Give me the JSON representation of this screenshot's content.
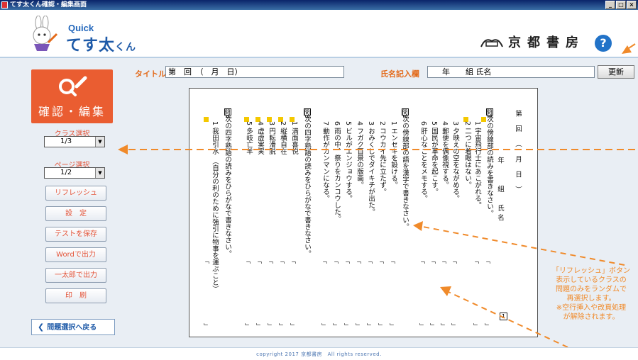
{
  "window": {
    "title": "てす太くん確認・編集画面",
    "buttons": [
      "_",
      "□",
      "×"
    ]
  },
  "header": {
    "logo_small": "Quick",
    "logo_main": "てす太",
    "logo_suffix": "くん",
    "publisher": "京都書房",
    "help": "?"
  },
  "topbar": {
    "title_label": "タイトル",
    "title_value": "第　回　（　月　日）",
    "name_label": "氏名記入欄",
    "name_value": "年　　組 氏名",
    "update_label": "更新"
  },
  "sidebar": {
    "main_button": "確認・編集",
    "class_label": "クラス選択",
    "class_value": "1/3",
    "page_label": "ページ選択",
    "page_value": "1/2",
    "buttons": [
      "リフレッシュ",
      "設　定",
      "テストを保存",
      "Wordで出力",
      "一太郎で出力",
      "印　刷"
    ],
    "back": "問題選択へ戻る"
  },
  "document": {
    "header_col": [
      "第",
      "回",
      "（",
      "月",
      "日）"
    ],
    "header_name": "年　　組　氏名",
    "q1": {
      "num": "問1",
      "text": "次の傍線部の読みを書きなさい。"
    },
    "q1_items": [
      "1 宇宙飛行士にあこがれる。",
      "2 二つに着眼はない。",
      "3 夕映えの空をながめる。",
      "4 郵便を偶像視する。",
      "5 国民が革命を起こす。",
      "6 肝心なことをメモする。"
    ],
    "q2": {
      "num": "問2",
      "text": "次の傍線部の語を漢字で書きなさい。"
    },
    "q2_items": [
      "1 エンセキを設ける。",
      "2 コウカイ先に立たず。",
      "3 おみくじでダイキチが出た。",
      "4 フガク百景の版画。",
      "5 ビルがエンジョウする。",
      "6 雨の中、祭りをカンコウした。",
      "7 動作がカンマンになる。"
    ],
    "q3": {
      "num": "問3",
      "text": "次の四字熟語の読みをひらがなで書きなさい。"
    },
    "q3_items": [
      "1 満面喜悦",
      "2 縦横自在",
      "3 円転滑脱",
      "4 虚虚実実",
      "5 多岐亡羊"
    ],
    "q4": {
      "num": "問4",
      "text": "次の四字熟語の読みをひらがなで書きなさい。"
    },
    "q4_items": [
      "1 我田引水　（自分の利のために強引に物事を運ぶこと）"
    ],
    "page_number": "1"
  },
  "annotation": "「リフレッシュ」ボタン\n表示しているクラスの\n問題のみをランダムで\n再選択します。\n※空行挿入や改頁処理\nが解除されます。",
  "footer": "copyright 2017 京都書房　All rights reserved.",
  "colors": {
    "accent": "#ea5d31",
    "brand": "#1e5aa8",
    "annotation": "#f08a2a"
  }
}
